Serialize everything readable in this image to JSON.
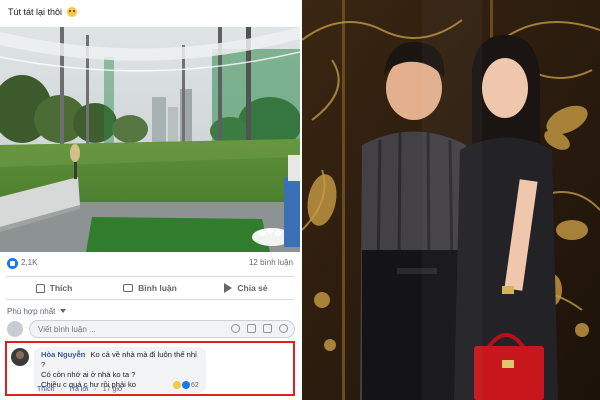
{
  "post": {
    "caption": "Tút tát lại thôi",
    "reaction_count": "2,1K",
    "comment_count": "12 bình luận",
    "actions": {
      "like": "Thích",
      "comment": "Bình luận",
      "share": "Chia sẻ"
    },
    "sort_label": "Phù hợp nhất",
    "composer_placeholder": "Viết bình luận ..."
  },
  "comment": {
    "author": "Hòa Nguyễn",
    "line1": "Ko cả về nhà mà đi luôn thế nhỉ ?",
    "line2": "Có còn nhớ ai ở nhà ko ta ?",
    "line3": "Chiều c quá c hư rồi phải ko",
    "react_count": "62",
    "like_label": "Thích",
    "reply_label": "Trả lời",
    "time": "17 giờ"
  },
  "colors": {
    "facebook_blue": "#1877f2",
    "highlight_border": "#e02020",
    "bag_red": "#c8161d"
  },
  "icons": [
    "like-reaction-icon",
    "thumb-up-icon",
    "comment-icon",
    "share-icon",
    "camera-icon",
    "gif-icon",
    "sticker-icon",
    "emoji-icon"
  ]
}
